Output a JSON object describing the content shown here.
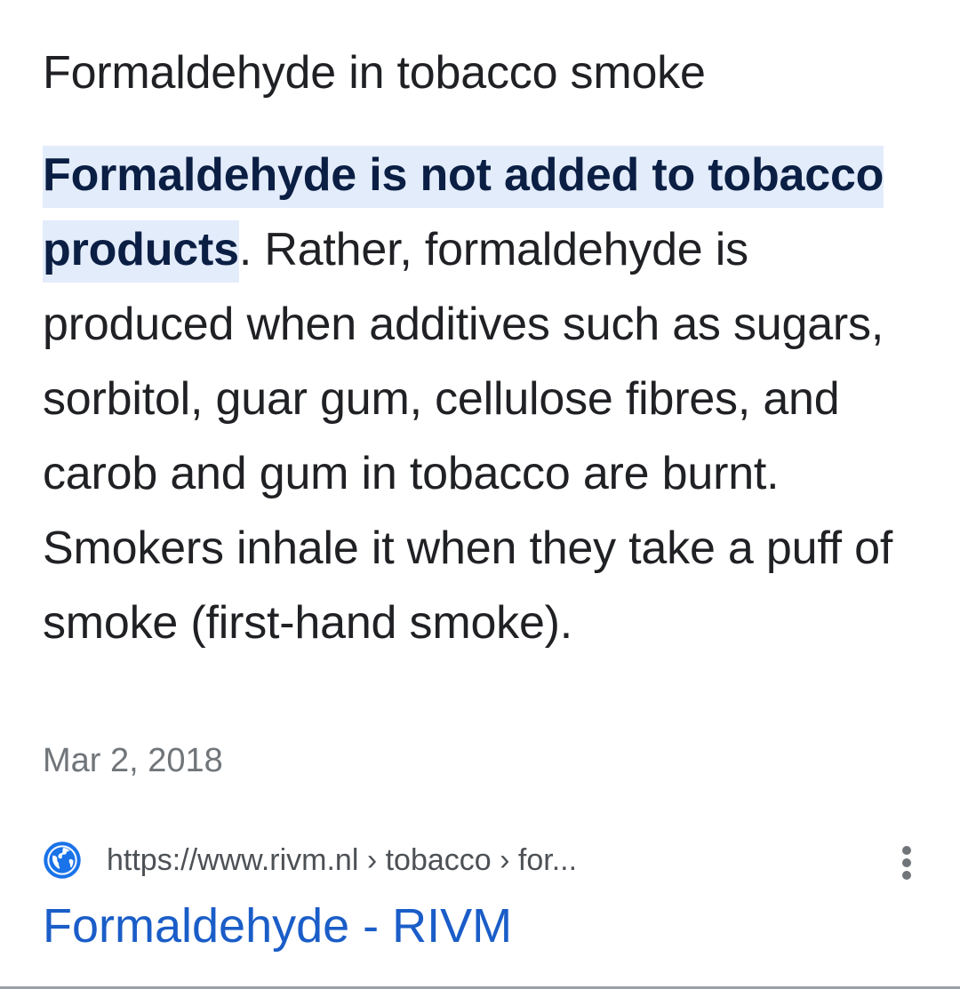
{
  "snippet": {
    "question": "Formaldehyde in tobacco smoke",
    "answer_highlight": "Formaldehyde is not added to tobacco products",
    "answer_rest": ". Rather, formaldehyde is produced when additives such as sugars, sorbitol, guar gum, cellulose fibres, and carob and gum in tobacco are burnt. Smokers inhale it when they take a puff of smoke (first-hand smoke).",
    "date": "Mar 2, 2018"
  },
  "source": {
    "icon": "globe-icon",
    "url": "https://www.rivm.nl › tobacco › for...",
    "title": "Formaldehyde - RIVM"
  },
  "colors": {
    "highlight_bg": "#e3ecfb",
    "link": "#1a5dc8",
    "text": "#202124",
    "muted": "#70757a",
    "globe": "#1a73e8"
  }
}
